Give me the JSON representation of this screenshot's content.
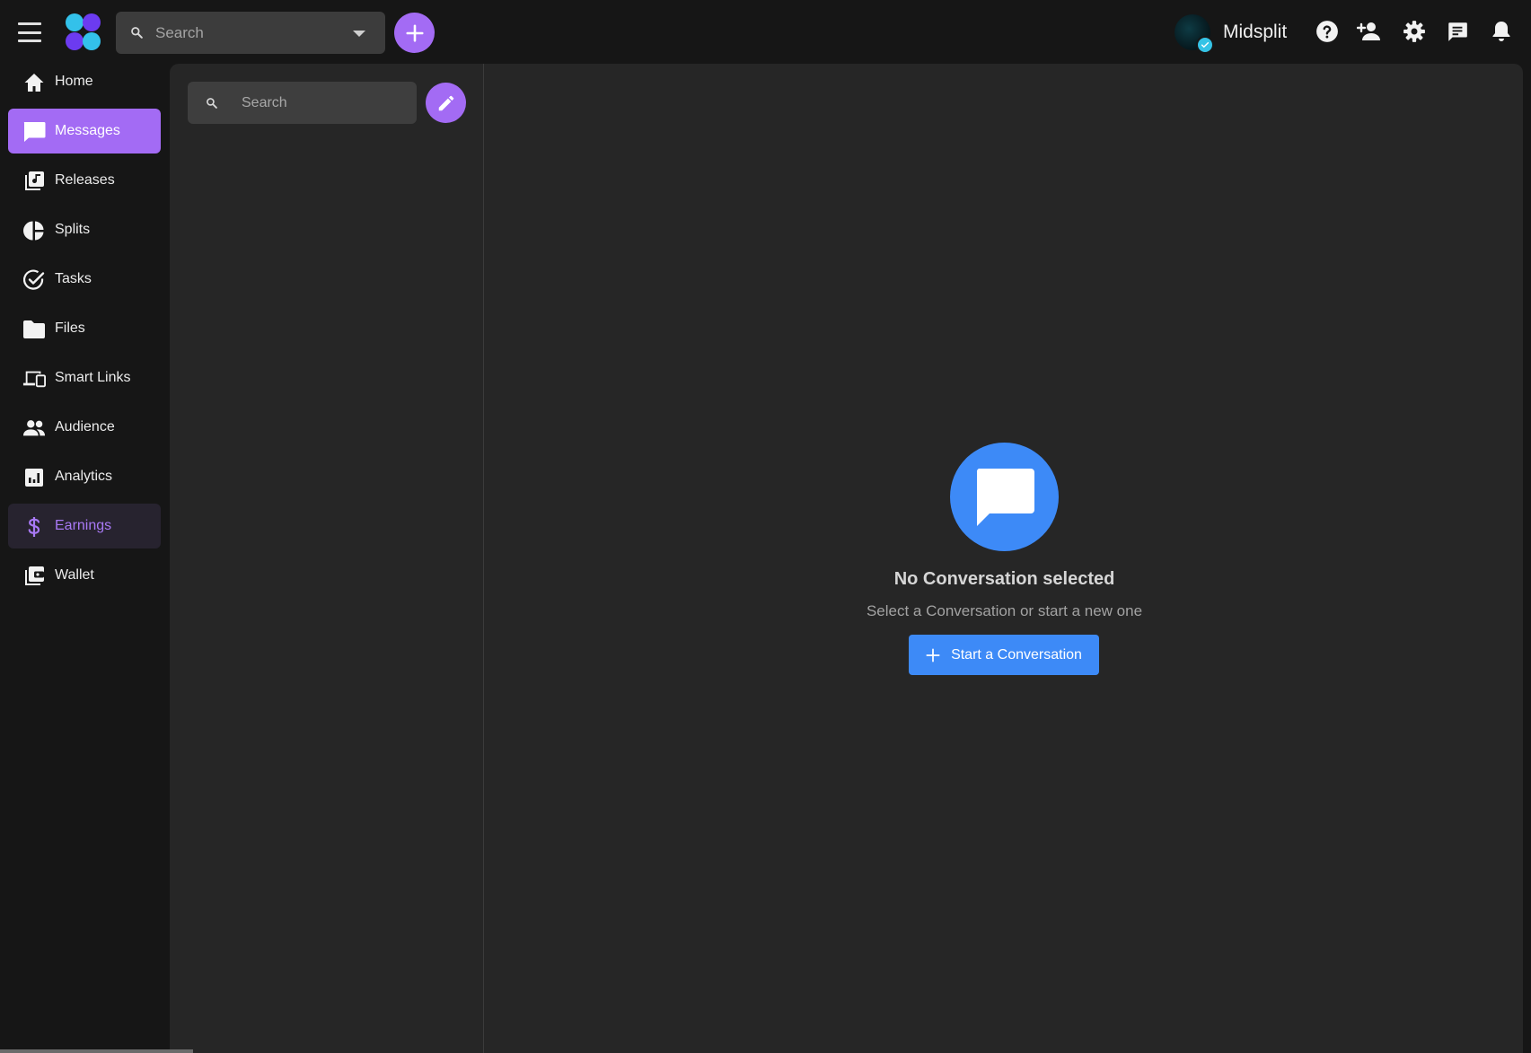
{
  "header": {
    "search_placeholder": "Search",
    "profile_name": "Midsplit"
  },
  "sidebar": {
    "items": [
      {
        "label": "Home",
        "icon": "home-icon"
      },
      {
        "label": "Messages",
        "icon": "chat-bubble-icon",
        "state": "active"
      },
      {
        "label": "Releases",
        "icon": "music-library-icon"
      },
      {
        "label": "Splits",
        "icon": "pie-chart-icon"
      },
      {
        "label": "Tasks",
        "icon": "check-circle-icon"
      },
      {
        "label": "Files",
        "icon": "folder-icon"
      },
      {
        "label": "Smart Links",
        "icon": "devices-icon"
      },
      {
        "label": "Audience",
        "icon": "people-icon"
      },
      {
        "label": "Analytics",
        "icon": "bar-chart-icon"
      },
      {
        "label": "Earnings",
        "icon": "dollar-icon",
        "state": "highlighted"
      },
      {
        "label": "Wallet",
        "icon": "wallet-icon"
      }
    ]
  },
  "conversations": {
    "search_placeholder": "Search"
  },
  "empty_state": {
    "title": "No Conversation selected",
    "subtitle": "Select a Conversation or start a new one",
    "button_label": "Start a Conversation"
  },
  "colors": {
    "accent_purple": "#a36bf4",
    "accent_blue": "#3d8af7",
    "verified_cyan": "#35c3e6",
    "background": "#161616",
    "panel": "#262626"
  }
}
